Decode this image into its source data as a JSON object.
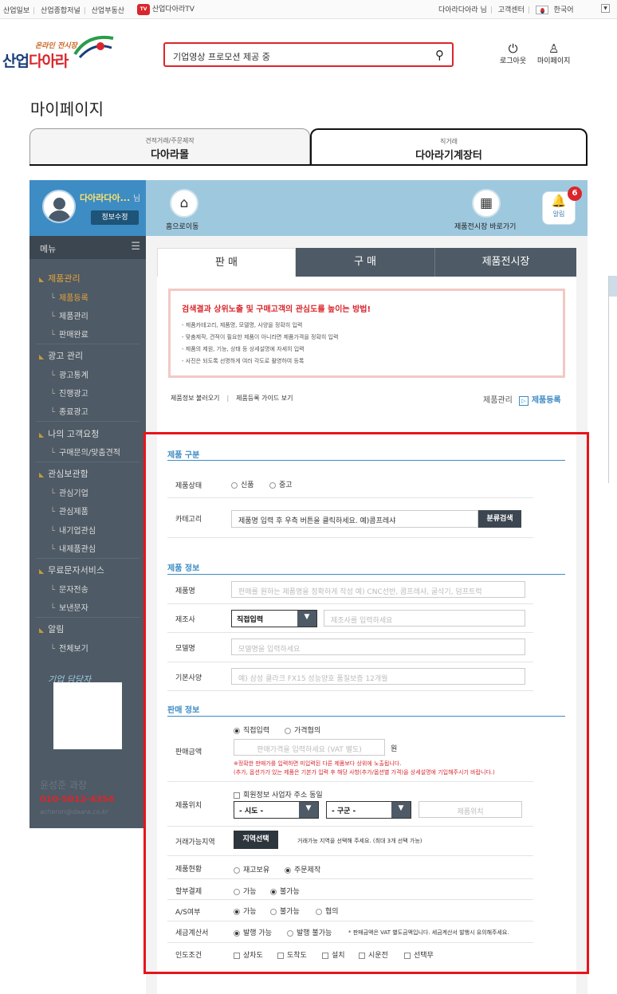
{
  "topbar": {
    "links": [
      "산업일보",
      "산업종합저널",
      "산업부동산"
    ],
    "tv_logo": "TV",
    "tv_label": "산업다아라TV",
    "user_greeting": "다아라다아라 님",
    "support": "고객센터",
    "language": "한국어"
  },
  "header": {
    "logo_subtitle": "온라인 전시장",
    "logo_a": "산업",
    "logo_b": "다아라",
    "search_text": "기업영상 프로모션 제공 중",
    "logout": "로그아웃",
    "mypage": "마이페이지"
  },
  "page_title": "마이페이지",
  "top_tabs": [
    {
      "sub": "견적거래/주문제작",
      "label": "다아라몰"
    },
    {
      "sub": "직거래",
      "label": "다아라기계장터"
    }
  ],
  "user": {
    "name": "다아라다아...",
    "suffix": "님",
    "edit": "정보수정"
  },
  "quick": {
    "home": "홈으로이동",
    "market": "제품전시장 바로가기",
    "alarm": "알림",
    "alarm_count": "6"
  },
  "menu": {
    "title": "메뉴",
    "toggle": "☰",
    "groups": [
      {
        "label": "제품관리",
        "items": [
          "제품등록",
          "제품관리",
          "판매완료"
        ]
      },
      {
        "label": "광고 관리",
        "items": [
          "광고통계",
          "진행광고",
          "종료광고"
        ]
      },
      {
        "label": "나의 고객요청",
        "items": [
          "구매문의/맞춤견적"
        ]
      },
      {
        "label": "관심보관함",
        "items": [
          "관심기업",
          "관심제품",
          "내기업관심",
          "내제품관심"
        ]
      },
      {
        "label": "무료문자서비스",
        "items": [
          "문자전송",
          "보낸문자"
        ]
      },
      {
        "label": "알림",
        "items": [
          "전체보기"
        ]
      }
    ]
  },
  "manager": {
    "label": "기업 담당자",
    "name": "윤성준 과장",
    "tel": "010-5012-4354",
    "email": "acheron@daara.co.kr"
  },
  "content_tabs": [
    "판 매",
    "구 매",
    "제품전시장"
  ],
  "tips": {
    "title": "검색결과 상위노출 및 구매고객의 관심도를 높이는 방법!",
    "lines": [
      "- 제품카테고리, 제품명, 모델명, 사양을 정확히 입력",
      "- 맞춤제작, 견적이 필요한 제품이 아니라면 제품가격을 정확히 입력",
      "- 제품의 제원, 기능, 상태 등 상세설명에 자세히 입력",
      "- 사진은 되도록 선명하게 여러 각도로 촬영하여 등록"
    ]
  },
  "links": {
    "load": "제품정보 불러오기",
    "divider": "|",
    "guide": "제품등록 가이드 보기",
    "manage": "제품관리",
    "arrow": "▷",
    "register": "제품등록"
  },
  "form": {
    "sec1": {
      "title": "제품 구분",
      "state_label": "제품상태",
      "state_opts": [
        "신품",
        "중고"
      ],
      "category_label": "카테고리",
      "category_value": "제품명 입력 후 우측 버튼을 클릭하세요.  예)콤프레샤",
      "category_btn": "분류검색"
    },
    "sec2": {
      "title": "제품 정보",
      "name_label": "제품명",
      "name_ph": "판매를 원하는 제품명을 정확하게 작성  예) CNC선반, 콤프레샤, 굴삭기, 덤프트럭",
      "maker_label": "제조사",
      "maker_select": "직접입력",
      "maker_ph": "제조사를 입력하세요",
      "model_label": "모델명",
      "model_ph": "모델명을 입력하세요",
      "spec_label": "기본사양",
      "spec_ph": "예) 삼성 클라크 FX15 성능양호 품질보증 12개월"
    },
    "sec3": {
      "title": "판매 정보",
      "price_label": "판매금액",
      "price_opts": [
        "직접입력",
        "가격협의"
      ],
      "price_ph": "판매가격을 입력하세요 (VAT 별도)",
      "price_unit": "원",
      "price_note1": "※정확한 판매가를 입력하면 미입력된 다른 제품보다 상위에 노출됩니다.",
      "price_note2": "(추가, 옵션가가 있는 제품은 기본가 입력 후 해당 사항(추가/옵션별 가격)을 상세설명에 기입해주시기 바랍니다.)",
      "location_label": "제품위치",
      "location_chk": "회원정보 사업자 주소 동일",
      "sido": "- 시도 -",
      "gugun": "- 구군 -",
      "location_ph": "제품위치",
      "area_label": "거래가능지역",
      "area_btn": "지역선택",
      "area_hint": "거래가능 지역을 선택해 주세요. (최대 3개 선택 가능)",
      "status_label": "제품현황",
      "status_opts": [
        "재고보유",
        "주문제작"
      ],
      "install_label": "할부결제",
      "install_opts": [
        "가능",
        "불가능"
      ],
      "as_label": "A/S여부",
      "as_opts": [
        "가능",
        "불가능",
        "협의"
      ],
      "tax_label": "세금계산서",
      "tax_opts": [
        "발행 가능",
        "발행 불가능"
      ],
      "tax_note": "* 판매금액은 VAT 별도금액입니다. 세금계산서 발행시 유의해주세요.",
      "delivery_label": "인도조건",
      "delivery_opts": [
        "상차도",
        "도착도",
        "설치",
        "시운전",
        "선택무"
      ]
    }
  },
  "colors": {
    "accent": "#3d8cc4",
    "red": "#d9262c",
    "sidebar": "#4e5a65",
    "highlight": "#e8141a"
  }
}
